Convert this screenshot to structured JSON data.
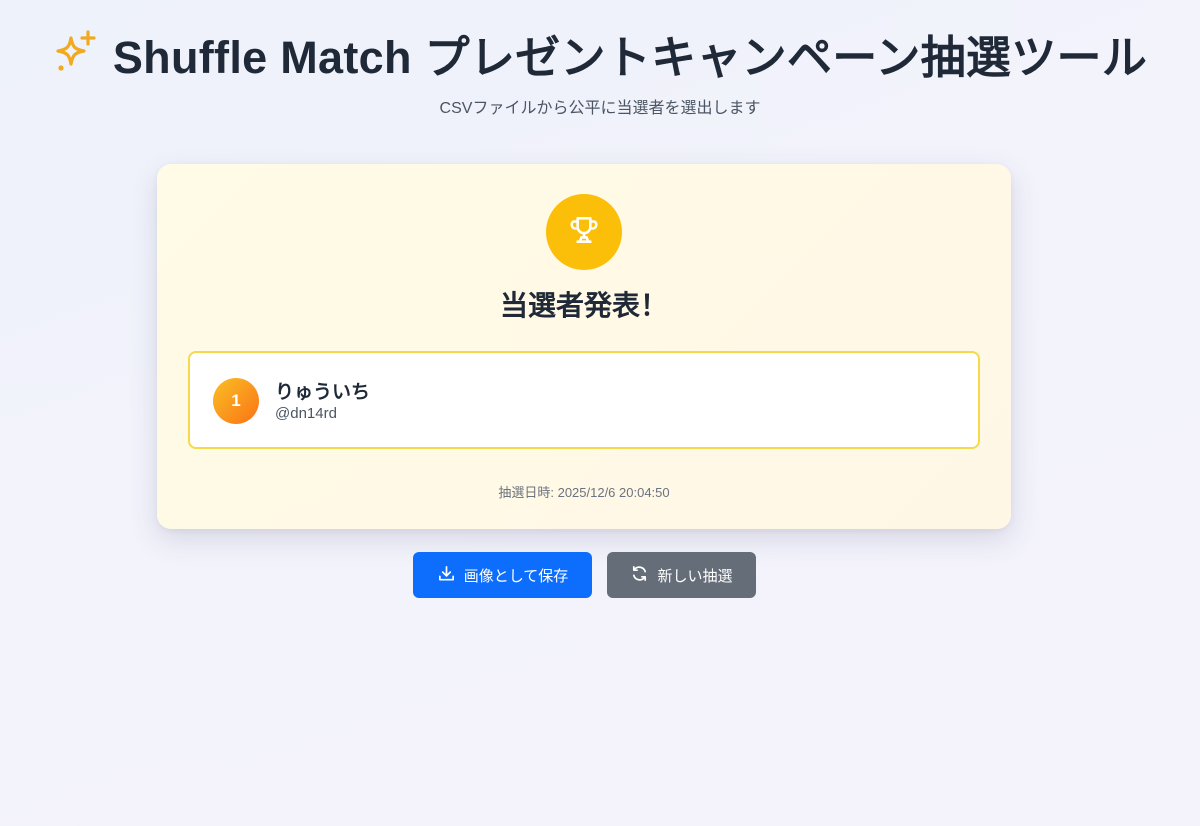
{
  "header": {
    "icon": "sparkles-icon",
    "title": "Shuffle Match プレゼントキャンペーン抽選ツール",
    "subtitle": "CSVファイルから公平に当選者を選出します"
  },
  "result_card": {
    "icon": "trophy-icon",
    "title": "当選者発表！",
    "winners": [
      {
        "rank": "1",
        "name": "りゅういち",
        "handle": "@dn14rd"
      }
    ],
    "draw_datetime": "抽選日時: 2025/12/6 20:04:50"
  },
  "actions": {
    "save_label": "画像として保存",
    "save_icon": "download-icon",
    "new_label": "新しい抽選",
    "new_icon": "refresh-icon"
  },
  "colors": {
    "accent_gold": "#fbbf0a",
    "primary_button": "#0d6efd",
    "secondary_button": "#646d78",
    "winner_border": "#f6d94a"
  }
}
